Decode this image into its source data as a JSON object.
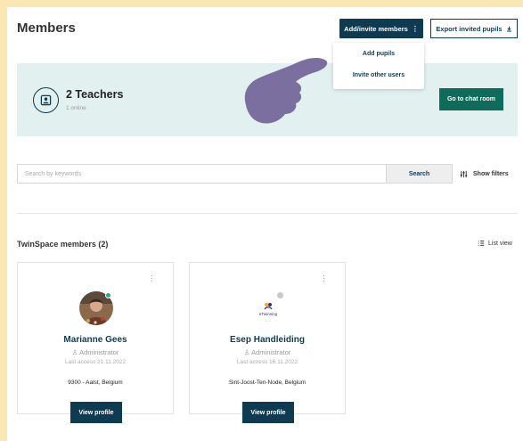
{
  "header": {
    "title": "Members",
    "add_invite_label": "Add/invite members",
    "export_label": "Export invited pupils"
  },
  "dropdown": {
    "items": [
      "Add pupils",
      "Invite other users"
    ]
  },
  "banner": {
    "title": "2 Teachers",
    "subtitle": "1 online",
    "chat_button": "Go to chat room"
  },
  "search": {
    "placeholder": "Search by keywords",
    "button": "Search",
    "filters_label": "Show filters"
  },
  "members_section": {
    "title": "TwinSpace members (2)",
    "list_view_label": "List view"
  },
  "members": [
    {
      "name": "Marianne Gees",
      "role": "Administrator",
      "last_access": "Last access 21.11.2022",
      "location": "9300 - Aalst, Belgium",
      "button": "View profile",
      "online": true
    },
    {
      "name": "Esep Handleiding",
      "role": "Administrator",
      "last_access": "Last access 16.11.2022",
      "location": "Sint-Joost-Ten-Node, Belgium",
      "button": "View profile",
      "online": false,
      "logo_text": "eTwinning"
    }
  ],
  "colors": {
    "frame": "#fbe7b3",
    "primary": "#0f3b52",
    "chat_button": "#0f6b5a",
    "banner_bg": "#e2f1ef",
    "pointer_hand": "#7b6fa0"
  }
}
